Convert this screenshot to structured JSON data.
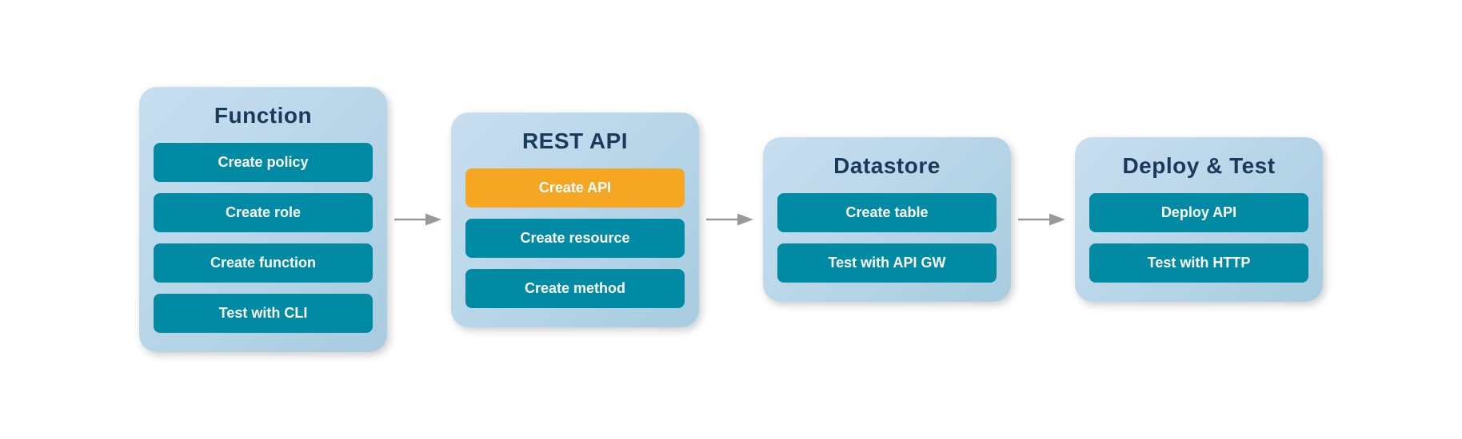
{
  "panels": [
    {
      "id": "function",
      "title": "Function",
      "items": [
        {
          "id": "create-policy",
          "label": "Create policy",
          "highlight": false
        },
        {
          "id": "create-role",
          "label": "Create role",
          "highlight": false
        },
        {
          "id": "create-function",
          "label": "Create function",
          "highlight": false
        },
        {
          "id": "test-cli",
          "label": "Test with CLI",
          "highlight": false
        }
      ]
    },
    {
      "id": "rest-api",
      "title": "REST API",
      "items": [
        {
          "id": "create-api",
          "label": "Create API",
          "highlight": true
        },
        {
          "id": "create-resource",
          "label": "Create resource",
          "highlight": false
        },
        {
          "id": "create-method",
          "label": "Create method",
          "highlight": false
        }
      ]
    },
    {
      "id": "datastore",
      "title": "Datastore",
      "items": [
        {
          "id": "create-table",
          "label": "Create table",
          "highlight": false
        },
        {
          "id": "test-api-gw",
          "label": "Test with API GW",
          "highlight": false
        }
      ]
    },
    {
      "id": "deploy-test",
      "title": "Deploy & Test",
      "items": [
        {
          "id": "deploy-api",
          "label": "Deploy API",
          "highlight": false
        },
        {
          "id": "test-http",
          "label": "Test with HTTP",
          "highlight": false
        }
      ]
    }
  ],
  "arrows": [
    {
      "id": "arrow-1"
    },
    {
      "id": "arrow-2"
    },
    {
      "id": "arrow-3"
    }
  ]
}
